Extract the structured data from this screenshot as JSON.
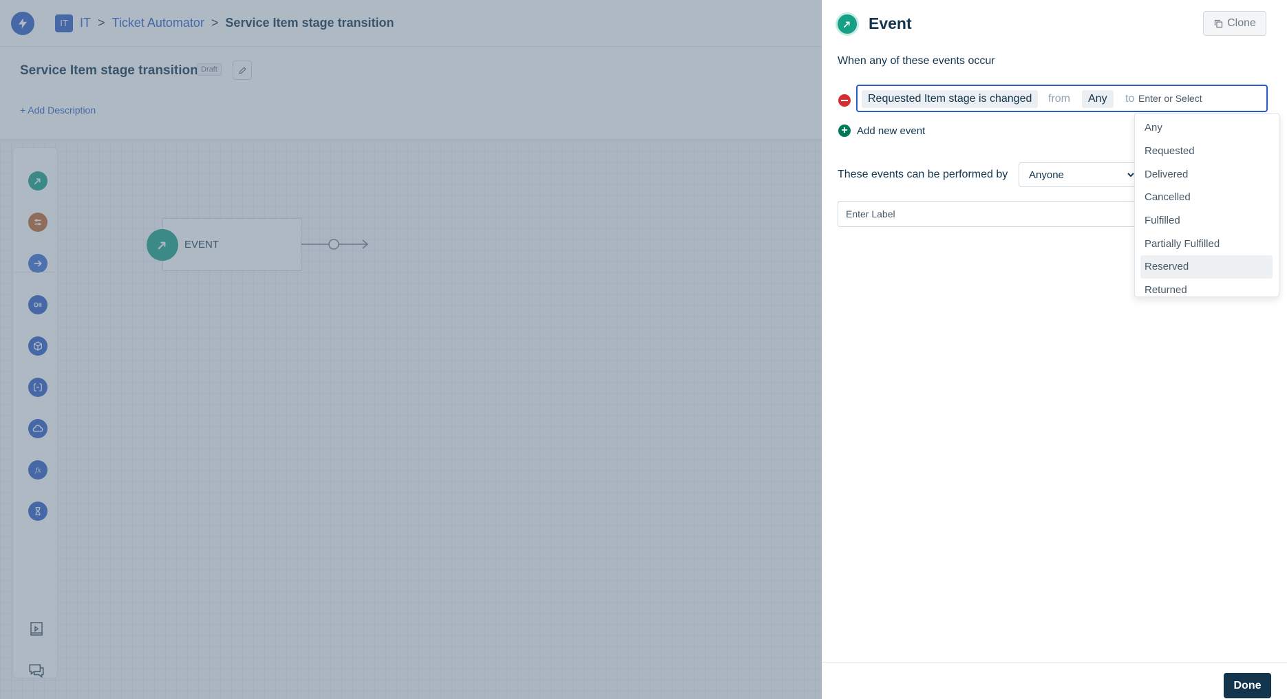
{
  "breadcrumb": {
    "workspace_badge": "IT",
    "workspace": "IT",
    "automator": "Ticket Automator",
    "current": "Service Item stage transition",
    "separator": ">"
  },
  "workflow": {
    "title": "Service Item stage transition",
    "status": "Draft",
    "add_description": "+ Add Description"
  },
  "canvas": {
    "node_label": "EVENT"
  },
  "toolbox": {
    "icons": [
      "event-icon",
      "condition-icon",
      "action-icon",
      "query-icon",
      "app-icon",
      "expression-icon",
      "webhook-icon",
      "function-icon",
      "timer-icon",
      "logs-icon",
      "chat-icon"
    ],
    "colors": {
      "event": "#16a085",
      "condition": "#c0642b",
      "action": "#3b6fd4",
      "other": "#2c5cc5"
    }
  },
  "panel": {
    "title": "Event",
    "clone_label": "Clone",
    "events_heading": "When any of these events occur",
    "event_row": {
      "event_name": "Requested Item stage is changed",
      "from_text": "from",
      "from_value": "Any",
      "to_text": "to",
      "to_placeholder": "Enter or Select"
    },
    "add_event_label": "Add new event",
    "performed_by_label": "These events can be performed by",
    "performed_by_value": "Anyone",
    "label_placeholder": "Enter Label",
    "done_label": "Done"
  },
  "stage_options": [
    "Any",
    "Requested",
    "Delivered",
    "Cancelled",
    "Fulfilled",
    "Partially Fulfilled",
    "Reserved",
    "Returned"
  ],
  "highlighted_option": "Reserved",
  "colors": {
    "primary": "#2c5cc5",
    "event_green": "#16a085",
    "danger": "#d72d30",
    "dark_button": "#12344d"
  }
}
